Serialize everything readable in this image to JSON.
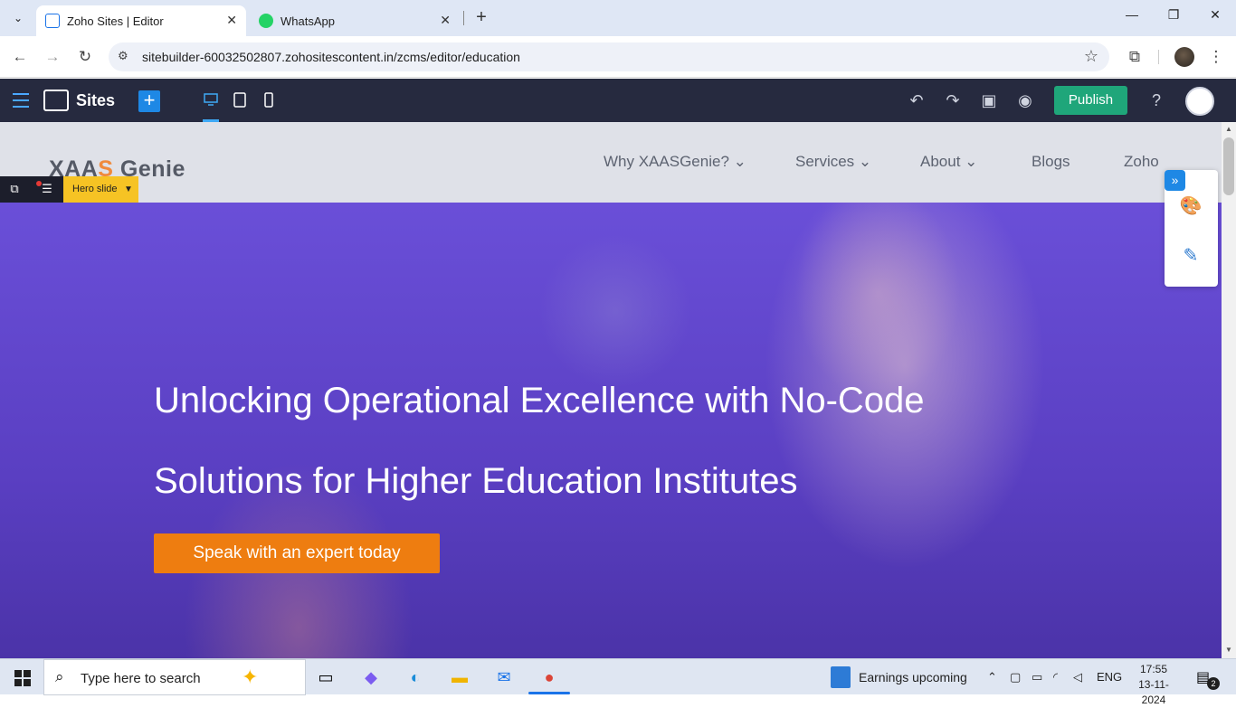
{
  "browser": {
    "tabs": [
      {
        "title": "Zoho Sites | Editor",
        "active": true
      },
      {
        "title": "WhatsApp",
        "active": false
      }
    ],
    "url": "sitebuilder-60032502807.zohositescontent.in/zcms/editor/education"
  },
  "editor": {
    "app_name": "Sites",
    "publish_label": "Publish",
    "section_tag": "Hero slide"
  },
  "site": {
    "logo": {
      "part1": "XAA",
      "mark": "S",
      "part2": " Genie"
    },
    "nav": [
      "Why XAASGenie? ⌄",
      "Services ⌄",
      "About ⌄",
      "Blogs",
      "Zoho"
    ],
    "hero_line1": "Unlocking Operational Excellence with No-Code",
    "hero_line2": "Solutions for Higher Education Institutes",
    "cta_label": "Speak with an expert today"
  },
  "taskbar": {
    "search_placeholder": "Type here to search",
    "news": "Earnings upcoming",
    "lang": "ENG",
    "time": "17:55",
    "date": "13-11-2024",
    "notifications": "2"
  },
  "colors": {
    "editor_bar": "#262a3f",
    "publish": "#1fa67a",
    "cta": "#ee7d10",
    "hero_overlay": "#5a3fc2",
    "section_tag": "#f6c324"
  }
}
